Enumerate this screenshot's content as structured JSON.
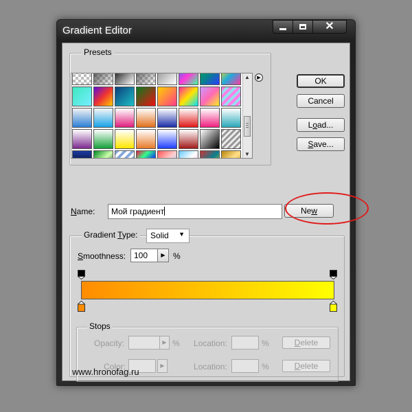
{
  "window": {
    "title": "Gradient Editor"
  },
  "presets": {
    "label": "Presets",
    "menu_icon": "play-circle-icon"
  },
  "buttons": {
    "ok": "OK",
    "cancel": "Cancel",
    "load_prefix": "L",
    "load_underlined": "o",
    "load_rest": "ad...",
    "save_underlined": "S",
    "save_rest": "ave...",
    "new_prefix": "Ne",
    "new_underlined": "w"
  },
  "name_field": {
    "label_underlined": "N",
    "label_rest": "ame:",
    "value": "Мой градиент"
  },
  "gradient_type": {
    "label_prefix": "Gradient ",
    "label_underlined": "T",
    "label_rest": "ype:",
    "value": "Solid"
  },
  "smoothness": {
    "label_underlined": "S",
    "label_rest": "moothness:",
    "value": "100",
    "unit": "%"
  },
  "gradient": {
    "start_color": "#ff8c00",
    "end_color": "#ffff00",
    "top_stop_color": "#000000"
  },
  "stops": {
    "label": "Stops",
    "opacity_label": "Opacity:",
    "opacity_unit": "%",
    "color_label": "Color:",
    "location_label": "Location:",
    "location_unit": "%",
    "delete_label_prefix": "",
    "delete_underlined": "D",
    "delete_rest": "elete"
  },
  "footer": {
    "text": "www.hronofag.ru"
  },
  "annotation": {
    "color": "#e01b1b"
  }
}
